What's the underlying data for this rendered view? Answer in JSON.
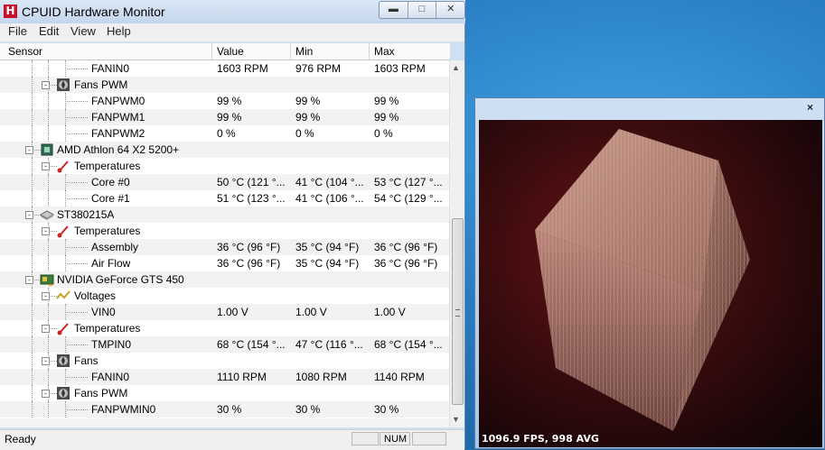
{
  "window": {
    "title": "CPUID Hardware Monitor",
    "app_icon_letter": "H",
    "buttons": [
      "minimize",
      "maximize",
      "close"
    ]
  },
  "menu": [
    "File",
    "Edit",
    "View",
    "Help"
  ],
  "columns": {
    "sensor": "Sensor",
    "value": "Value",
    "min": "Min",
    "max": "Max"
  },
  "rows": [
    {
      "indent": 3,
      "name": "FANIN0",
      "value": "1603 RPM",
      "min": "976 RPM",
      "max": "1603 RPM"
    },
    {
      "indent": 2,
      "name": "Fans PWM",
      "icon": "fan-icon",
      "expander": "-"
    },
    {
      "indent": 3,
      "name": "FANPWM0",
      "value": "99 %",
      "min": "99 %",
      "max": "99 %"
    },
    {
      "indent": 3,
      "name": "FANPWM1",
      "value": "99 %",
      "min": "99 %",
      "max": "99 %"
    },
    {
      "indent": 3,
      "name": "FANPWM2",
      "value": "0 %",
      "min": "0 %",
      "max": "0 %"
    },
    {
      "indent": 1,
      "name": "AMD Athlon 64 X2 5200+",
      "icon": "cpu-icon",
      "expander": "-"
    },
    {
      "indent": 2,
      "name": "Temperatures",
      "icon": "thermometer-icon",
      "expander": "-"
    },
    {
      "indent": 3,
      "name": "Core #0",
      "value": "50 °C  (121 °...",
      "min": "41 °C  (104 °...",
      "max": "53 °C  (127 °..."
    },
    {
      "indent": 3,
      "name": "Core #1",
      "value": "51 °C  (123 °...",
      "min": "41 °C  (106 °...",
      "max": "54 °C  (129 °..."
    },
    {
      "indent": 1,
      "name": "ST380215A",
      "icon": "hard-drive-icon",
      "expander": "-"
    },
    {
      "indent": 2,
      "name": "Temperatures",
      "icon": "thermometer-icon",
      "expander": "-"
    },
    {
      "indent": 3,
      "name": "Assembly",
      "value": "36 °C  (96 °F)",
      "min": "35 °C  (94 °F)",
      "max": "36 °C  (96 °F)"
    },
    {
      "indent": 3,
      "name": "Air Flow",
      "value": "36 °C  (96 °F)",
      "min": "35 °C  (94 °F)",
      "max": "36 °C  (96 °F)"
    },
    {
      "indent": 1,
      "name": "NVIDIA GeForce GTS 450",
      "icon": "graphics-card-icon",
      "expander": "-"
    },
    {
      "indent": 2,
      "name": "Voltages",
      "icon": "voltage-icon",
      "expander": "-"
    },
    {
      "indent": 3,
      "name": "VIN0",
      "value": "1.00 V",
      "min": "1.00 V",
      "max": "1.00 V"
    },
    {
      "indent": 2,
      "name": "Temperatures",
      "icon": "thermometer-icon",
      "expander": "-"
    },
    {
      "indent": 3,
      "name": "TMPIN0",
      "value": "68 °C  (154 °...",
      "min": "47 °C  (116 °...",
      "max": "68 °C  (154 °..."
    },
    {
      "indent": 2,
      "name": "Fans",
      "icon": "fan-icon",
      "expander": "-"
    },
    {
      "indent": 3,
      "name": "FANIN0",
      "value": "1110 RPM",
      "min": "1080 RPM",
      "max": "1140 RPM"
    },
    {
      "indent": 2,
      "name": "Fans PWM",
      "icon": "fan-icon",
      "expander": "-"
    },
    {
      "indent": 3,
      "name": "FANPWMIN0",
      "value": "30 %",
      "min": "30 %",
      "max": "30 %"
    }
  ],
  "status": {
    "text": "Ready",
    "num": "NUM"
  },
  "fur": {
    "close": "×",
    "fps": "1096.9 FPS, 998 AVG"
  }
}
